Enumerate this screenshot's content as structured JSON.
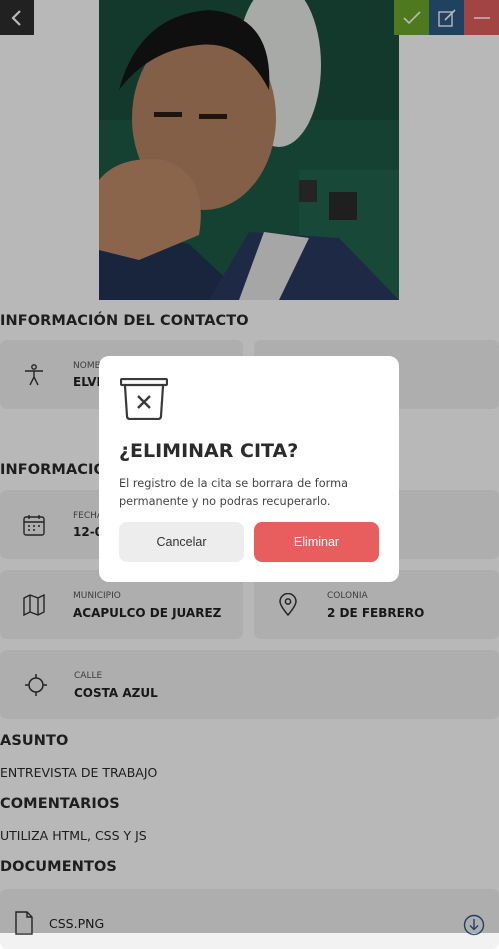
{
  "header": {
    "back_icon": "chevron-left-icon",
    "actions": [
      {
        "icon": "check-icon",
        "color": "#6ea82c"
      },
      {
        "icon": "edit-icon",
        "color": "#2f5b86"
      },
      {
        "icon": "minus-icon",
        "color": "#e15f5f"
      }
    ]
  },
  "contact": {
    "section_title": "INFORMACIÓN DEL CONTACTO",
    "name_label": "NOMBRE",
    "name_value": "ELVIS"
  },
  "appointment": {
    "section_title": "INFORMACIÓN",
    "date_label": "FECHA",
    "date_value": "12-07",
    "municipio_label": "MUNICIPIO",
    "municipio_value": "ACAPULCO DE JUAREZ",
    "colonia_label": "COLONIA",
    "colonia_value": "2 DE FEBRERO",
    "calle_label": "CALLE",
    "calle_value": "COSTA AZUL"
  },
  "asunto": {
    "title": "ASUNTO",
    "value": "ENTREVISTA DE TRABAJO"
  },
  "comentarios": {
    "title": "COMENTARIOS",
    "value": "UTILIZA HTML, CSS Y JS"
  },
  "documentos": {
    "title": "DOCUMENTOS",
    "file_name": "CSS.PNG"
  },
  "modal": {
    "title": "¿ELIMINAR CITA?",
    "message": "El registro de la cita se borrara de forma permanente y no podras recuperarlo.",
    "cancel_label": "Cancelar",
    "delete_label": "Eliminar",
    "icon": "delete-bin-icon"
  }
}
